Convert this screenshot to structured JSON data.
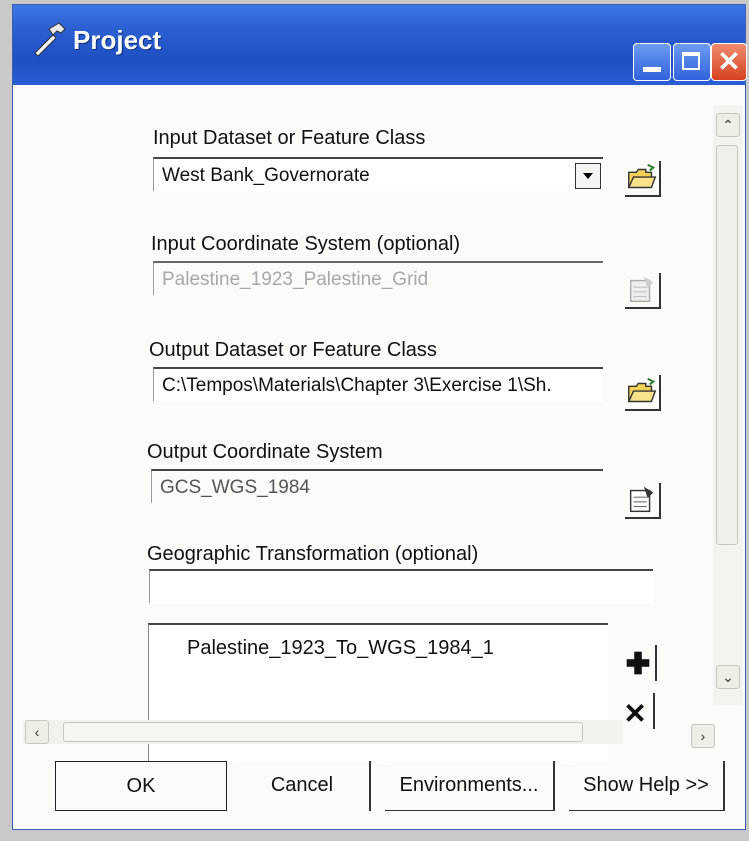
{
  "window": {
    "title": "Project"
  },
  "fields": {
    "input_dataset": {
      "label": "Input Dataset or Feature Class",
      "value": "West Bank_Governorate"
    },
    "input_coord": {
      "label": "Input Coordinate System (optional)",
      "value": "Palestine_1923_Palestine_Grid"
    },
    "output_dataset": {
      "label": "Output Dataset or Feature Class",
      "value": "C:\\Tempos\\Materials\\Chapter 3\\Exercise 1\\Sh."
    },
    "output_coord": {
      "label": "Output Coordinate System",
      "value": "GCS_WGS_1984"
    },
    "geo_transform": {
      "label": "Geographic Transformation (optional)",
      "value": "",
      "list": [
        "Palestine_1923_To_WGS_1984_1"
      ]
    }
  },
  "buttons": {
    "ok": "OK",
    "cancel": "Cancel",
    "environments": "Environments...",
    "show_help": "Show Help >>"
  },
  "icons": {
    "open_folder": "open-folder-icon",
    "coord_properties": "spatial-reference-properties-icon",
    "add": "plus-icon",
    "remove": "x-icon"
  },
  "colors": {
    "titlebar": "#2c5fd2",
    "close": "#d6431f",
    "window_bg": "#fbfbf8"
  }
}
